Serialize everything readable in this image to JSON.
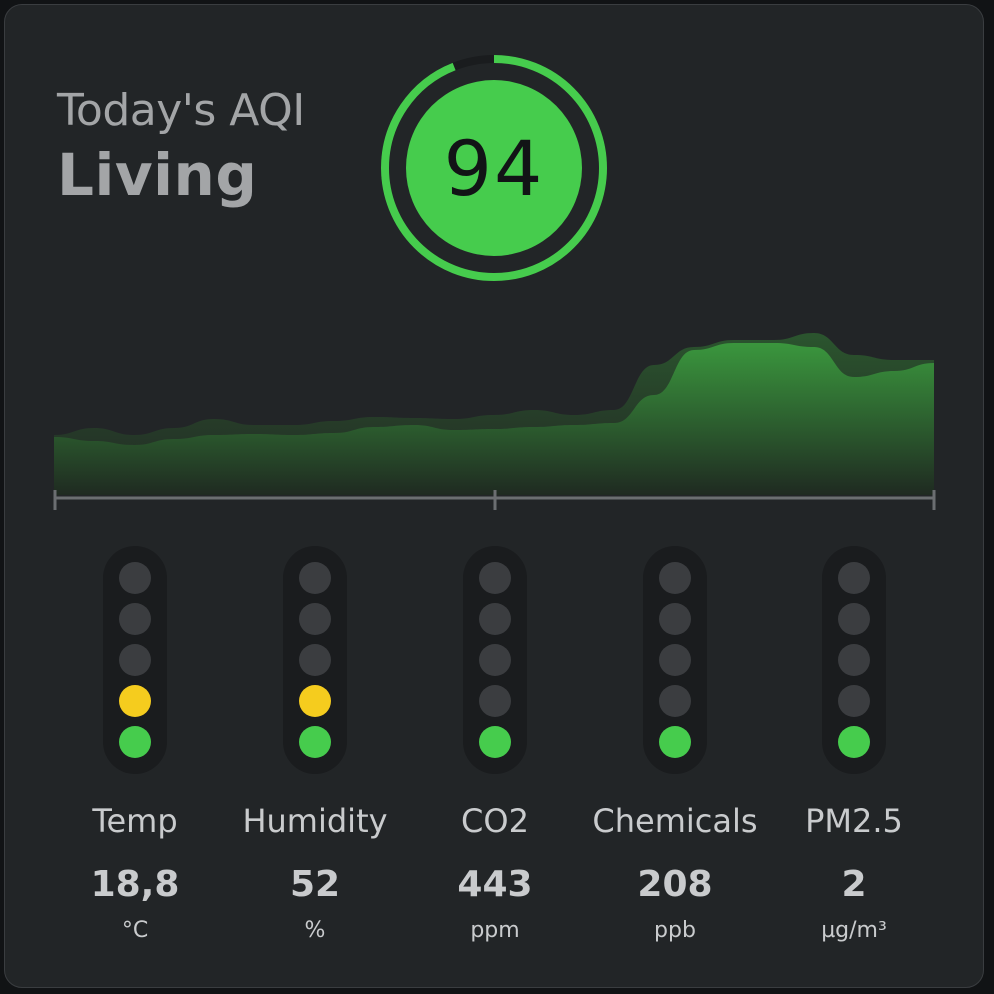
{
  "header": {
    "subtitle": "Today's AQI",
    "room": "Living"
  },
  "aqi": {
    "value": "94",
    "percent": 94,
    "color": "#46cc4d",
    "track_color": "#1a1c1e"
  },
  "graph": {
    "fill_color": "#2e7a30",
    "series": [
      {
        "name": "primary",
        "values": [
          58,
          54,
          50,
          56,
          60,
          61,
          60,
          62,
          68,
          70,
          65,
          66,
          68,
          70,
          72,
          100,
          145,
          152,
          152,
          148,
          118,
          124,
          132
        ]
      },
      {
        "name": "secondary",
        "values": [
          60,
          67,
          60,
          67,
          76,
          70,
          70,
          74,
          78,
          77,
          76,
          80,
          85,
          80,
          85,
          130,
          148,
          155,
          155,
          162,
          140,
          135,
          135
        ]
      }
    ]
  },
  "palette": {
    "green": "#46cc4d",
    "yellow": "#f5cc1e",
    "off": "#3b3d40"
  },
  "metrics": [
    {
      "label": "Temp",
      "value": "18,8",
      "unit": "°C",
      "level": 2,
      "colors": [
        "green",
        "yellow"
      ]
    },
    {
      "label": "Humidity",
      "value": "52",
      "unit": "%",
      "level": 2,
      "colors": [
        "green",
        "yellow"
      ]
    },
    {
      "label": "CO2",
      "value": "443",
      "unit": "ppm",
      "level": 1,
      "colors": [
        "green"
      ]
    },
    {
      "label": "Chemicals",
      "value": "208",
      "unit": "ppb",
      "level": 1,
      "colors": [
        "green"
      ]
    },
    {
      "label": "PM2.5",
      "value": "2",
      "unit": "µg/m³",
      "level": 1,
      "colors": [
        "green"
      ]
    }
  ]
}
